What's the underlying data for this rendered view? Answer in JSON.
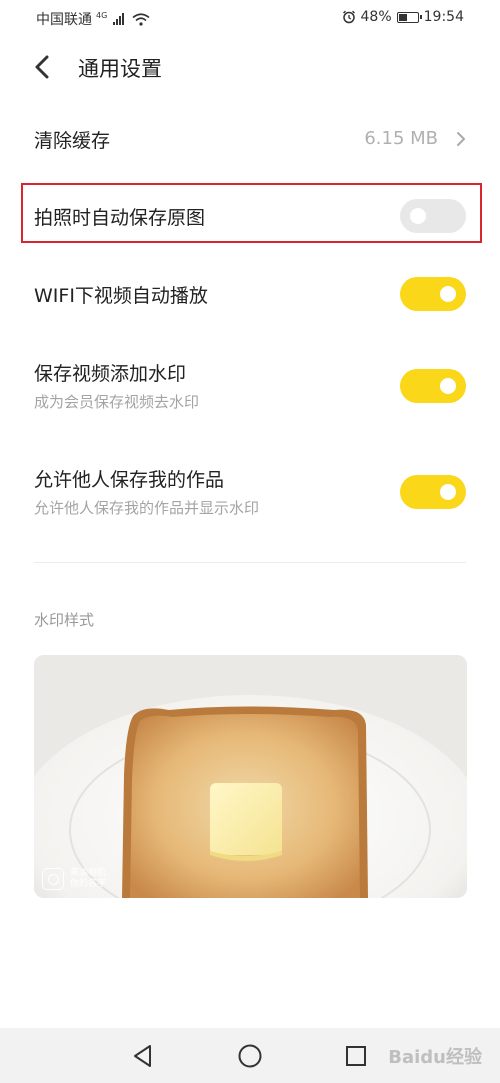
{
  "status_bar": {
    "carrier": "中国联通",
    "network_type": "4G",
    "battery_percent": "48%",
    "battery_level": 0.48,
    "time": "19:54"
  },
  "header": {
    "back_icon": "chevron-left-icon",
    "title": "通用设置"
  },
  "settings": {
    "clear_cache": {
      "title": "清除缓存",
      "value": "6.15 MB"
    },
    "save_original": {
      "title": "拍照时自动保存原图",
      "enabled": false
    },
    "wifi_autoplay": {
      "title": "WIFI下视频自动播放",
      "enabled": true
    },
    "video_watermark": {
      "title": "保存视频添加水印",
      "subtitle": "成为会员保存视频去水印",
      "enabled": true
    },
    "allow_save": {
      "title": "允许他人保存我的作品",
      "subtitle": "允许他人保存我的作品并显示水印",
      "enabled": true
    }
  },
  "watermark_section": {
    "label": "水印样式",
    "preview_text_1": "黄油相机",
    "preview_text_2": "你的名字"
  },
  "nav_bar": {
    "buttons": [
      "back-triangle-icon",
      "home-circle-icon",
      "recent-square-icon"
    ]
  },
  "site_watermark": "Baidu经验",
  "colors": {
    "accent": "#fbd71a",
    "toggle_off": "#e8e8e8",
    "highlight": "#d9252f"
  }
}
